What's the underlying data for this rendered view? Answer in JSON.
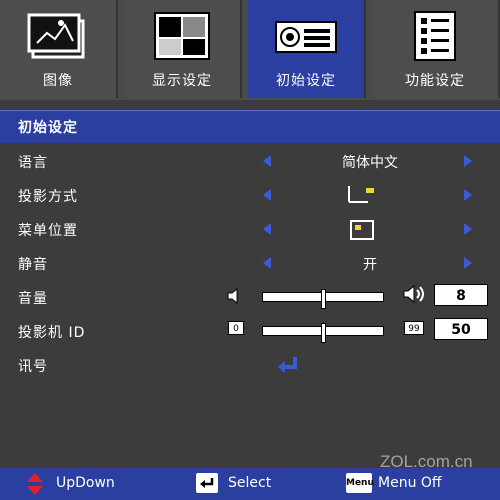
{
  "tabs": [
    {
      "label": "图像",
      "icon": "picture-frame-icon"
    },
    {
      "label": "显示设定",
      "icon": "display-pattern-icon"
    },
    {
      "label": "初始设定",
      "icon": "projector-icon"
    },
    {
      "label": "功能设定",
      "icon": "document-list-icon"
    }
  ],
  "section": {
    "title": "初始设定"
  },
  "rows": {
    "language": {
      "label": "语言",
      "value": "简体中文"
    },
    "projection": {
      "label": "投影方式",
      "value_icon": "projection-mode-icon"
    },
    "menu_position": {
      "label": "菜单位置",
      "value_icon": "menu-position-icon"
    },
    "mute": {
      "label": "静音",
      "value": "开"
    },
    "volume": {
      "label": "音量",
      "value": "8",
      "level": 0.5
    },
    "projector_id": {
      "label": "投影机 ID",
      "min": "0",
      "max": "99",
      "value": "50",
      "level": 0.5
    },
    "signal": {
      "label": "讯号",
      "action_icon": "enter-arrow-icon"
    }
  },
  "footer": {
    "updown": "UpDown",
    "select": "Select",
    "menu_key": "Menu",
    "menu_off": "Menu Off"
  },
  "watermark": "ZOL.com.cn",
  "colors": {
    "accent": "#2a3fa0",
    "arrow": "#3b5bd6",
    "background": "#3c3c3c",
    "up_down_icon": "#e0202a"
  }
}
